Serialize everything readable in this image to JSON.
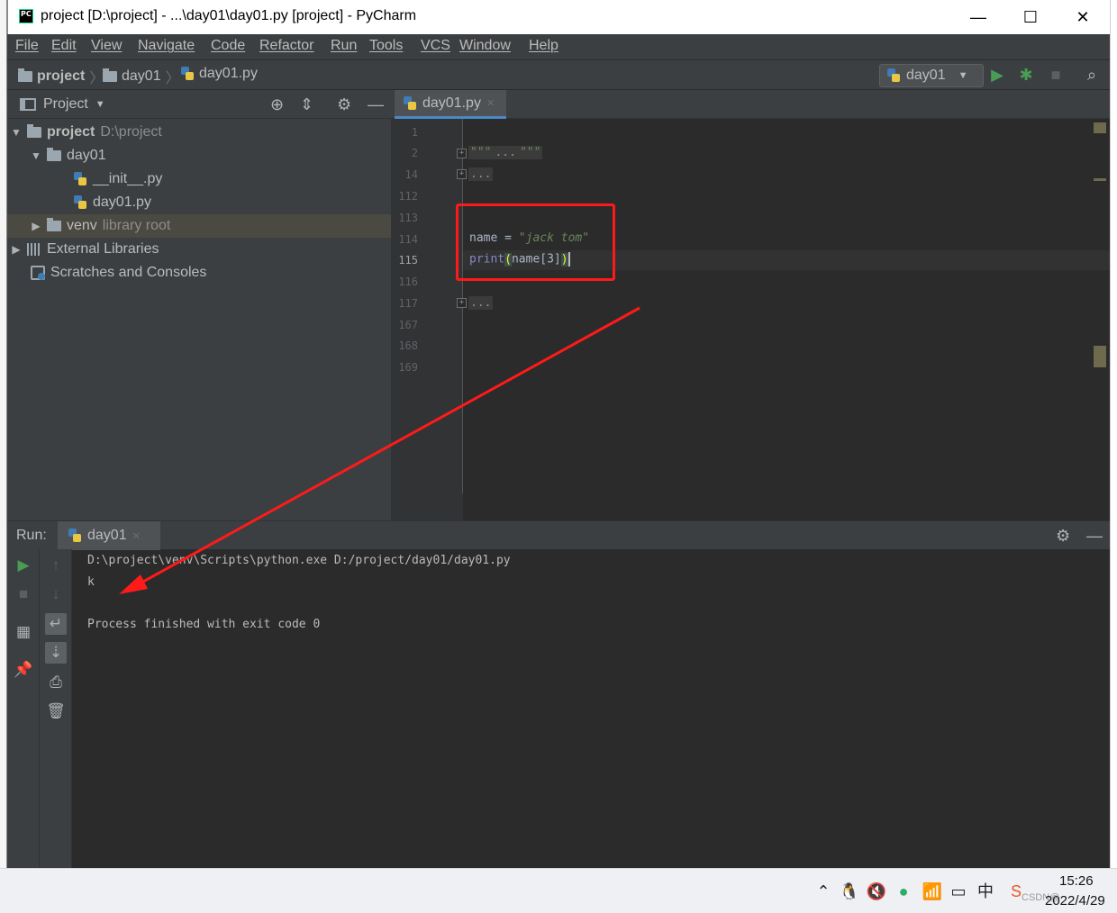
{
  "window": {
    "title": "project [D:\\project] - ...\\day01\\day01.py [project] - PyCharm",
    "app_icon_text": "PC",
    "minimize": "—",
    "maximize": "☐",
    "close": "✕"
  },
  "menu": [
    "File",
    "Edit",
    "View",
    "Navigate",
    "Code",
    "Refactor",
    "Run",
    "Tools",
    "VCS",
    "Window",
    "Help"
  ],
  "breadcrumb": {
    "project": "project",
    "folder": "day01",
    "file": "day01.py",
    "separator": "〉"
  },
  "run_config": {
    "name": "day01",
    "run_icon": "run-icon",
    "debug_icon": "debug-icon",
    "stop_icon": "stop-icon",
    "search_icon": "search-icon"
  },
  "project_panel": {
    "title": "Project",
    "tree": {
      "root_name": "project",
      "root_path": "D:\\project",
      "folder": "day01",
      "file1": "__init__.py",
      "file2": "day01.py",
      "venv": "venv",
      "venv_note": "library root",
      "ext_libs": "External Libraries",
      "scratches": "Scratches and Consoles"
    }
  },
  "editor": {
    "tab_label": "day01.py",
    "tab_close": "✕",
    "line_numbers": [
      "1",
      "2",
      "14",
      "112",
      "113",
      "114",
      "115",
      "116",
      "117",
      "167",
      "168",
      "169"
    ],
    "current_line": "115",
    "folded_docstring_open": "\"\"\"",
    "folded_docstring_dots": "...",
    "folded_docstring_close": "\"\"\"",
    "folded_ellipsis": "...",
    "code_assign_var": "name",
    "code_assign_op": " = ",
    "code_string": "\"jack tom\"",
    "code_print": "print",
    "code_open_paren": "(",
    "code_arg": "name[3]",
    "code_close_paren": ")"
  },
  "run_panel": {
    "label": "Run:",
    "tab": "day01",
    "tab_close": "✕",
    "console": {
      "command": "D:\\project\\venv\\Scripts\\python.exe D:/project/day01/day01.py",
      "output": "k",
      "exit": "Process finished with exit code 0"
    }
  },
  "taskbar": {
    "time": "15:26",
    "date": "2022/4/29",
    "watermark": "CSDN@",
    "ime": "中"
  },
  "colors": {
    "annotation": "#ff1a1a",
    "run_green": "#499c54",
    "ide_background": "#2b2b2b"
  }
}
